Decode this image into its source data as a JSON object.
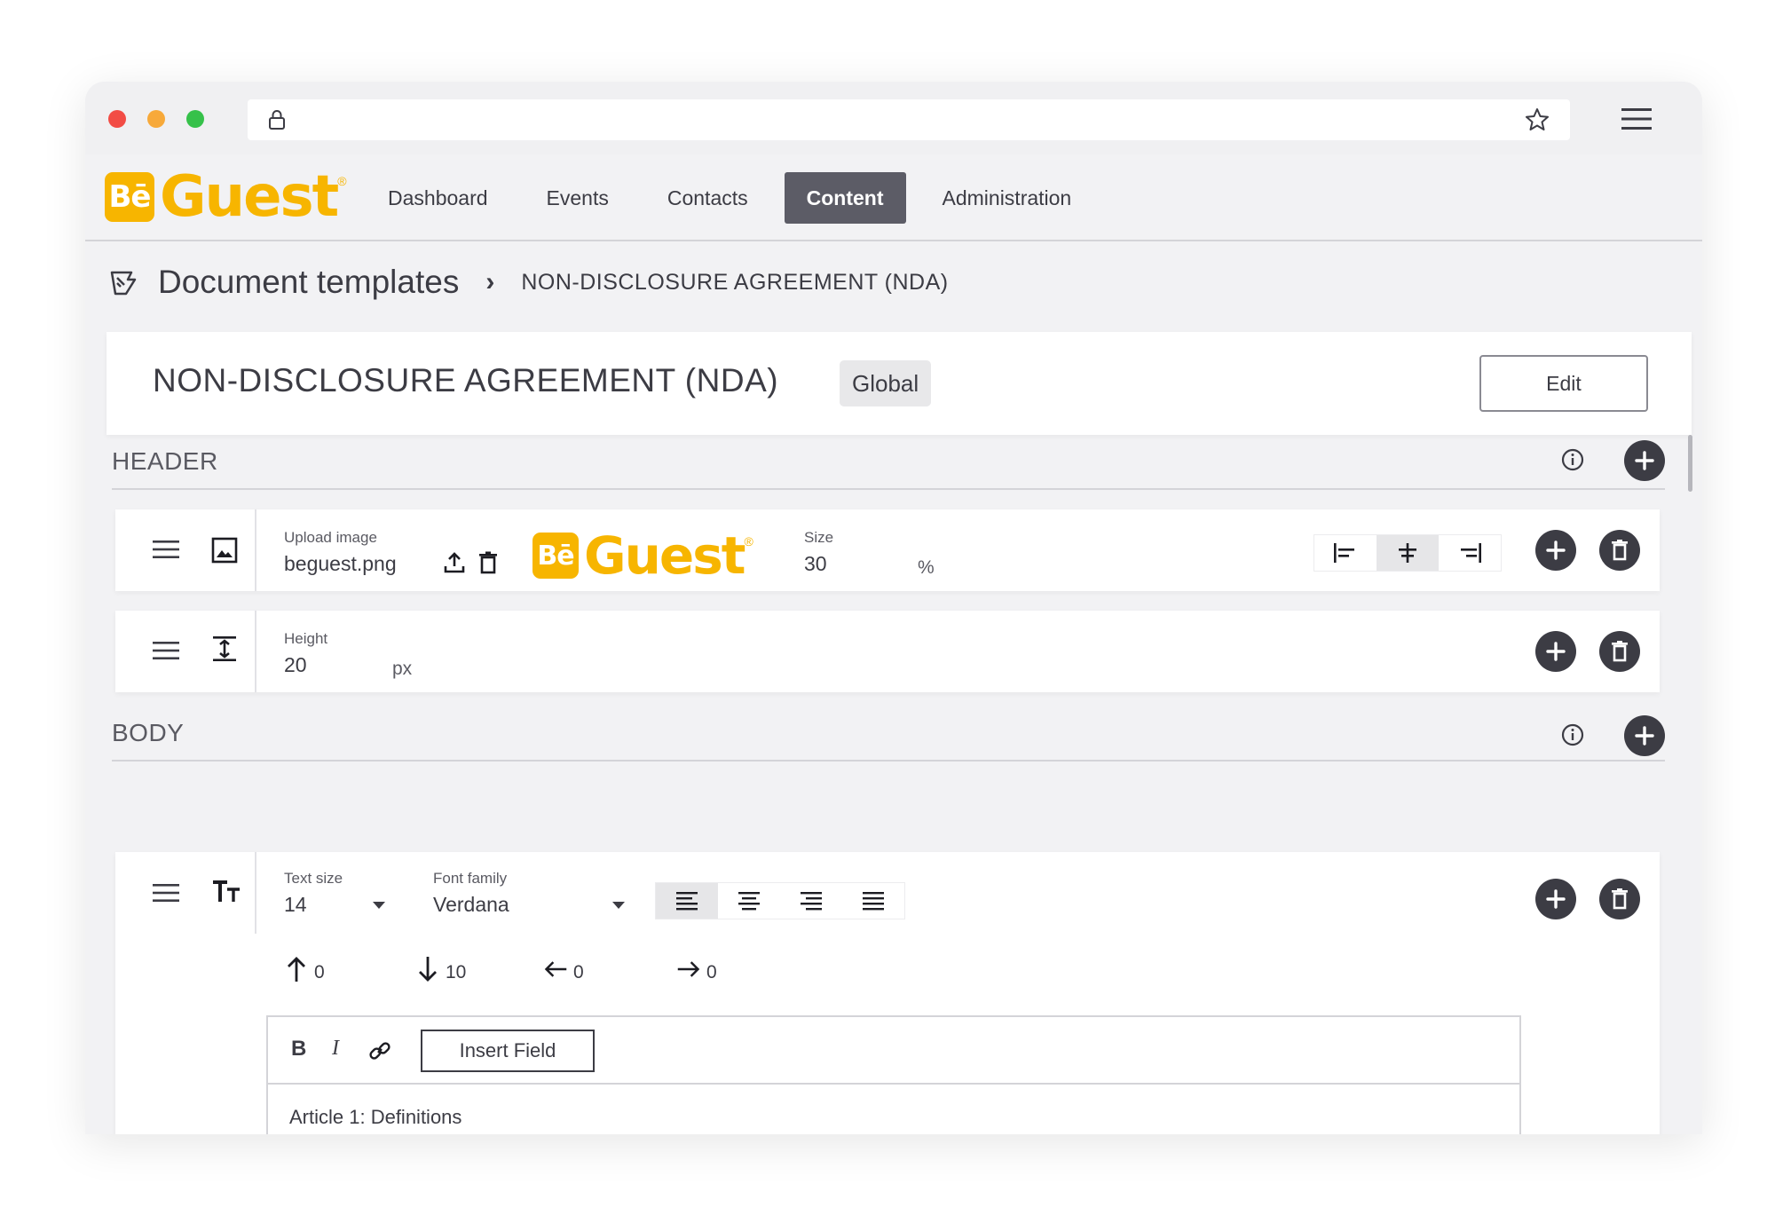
{
  "brand": {
    "logo_mark": "Bē",
    "logo_word": "Guest",
    "logo_reg": "®",
    "color": "#f7b500"
  },
  "nav": {
    "items": [
      {
        "label": "Dashboard"
      },
      {
        "label": "Events"
      },
      {
        "label": "Contacts"
      },
      {
        "label": "Content",
        "active": true
      },
      {
        "label": "Administration"
      }
    ]
  },
  "breadcrumb": {
    "root": "Document templates",
    "separator": "›",
    "current": "NON-DISCLOSURE AGREEMENT (NDA)"
  },
  "document": {
    "title": "NON-DISCLOSURE AGREEMENT (NDA)",
    "scope_badge": "Global",
    "edit_label": "Edit"
  },
  "header_section": {
    "label": "HEADER",
    "image_block": {
      "upload_label": "Upload image",
      "file_name": "beguest.png",
      "size_label": "Size",
      "size_value": "30",
      "size_unit": "%",
      "alignment_selected": "center"
    },
    "spacer_block": {
      "height_label": "Height",
      "height_value": "20",
      "height_unit": "px"
    }
  },
  "body_section": {
    "label": "BODY",
    "text_block": {
      "text_size_label": "Text size",
      "text_size_value": "14",
      "font_family_label": "Font family",
      "font_family_value": "Verdana",
      "alignment_selected": "left",
      "spacing": {
        "top": "0",
        "bottom": "10",
        "left": "0",
        "right": "0"
      },
      "toolbar": {
        "bold": "B",
        "italic": "I",
        "insert_field": "Insert Field"
      },
      "content": "Article 1: Definitions"
    }
  },
  "icons": [
    "lock-icon",
    "star-icon",
    "hamburger-icon",
    "document-icon",
    "info-icon",
    "plus-icon",
    "trash-icon",
    "drag-handle-icon",
    "image-icon",
    "vertical-spacer-icon",
    "text-size-icon",
    "upload-icon",
    "link-icon"
  ]
}
